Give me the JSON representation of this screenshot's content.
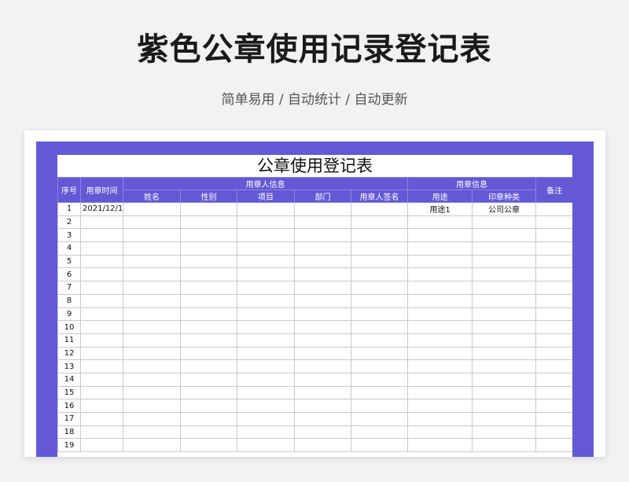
{
  "page": {
    "title": "紫色公章使用记录登记表",
    "subtitle": "简单易用 / 自动统计 / 自动更新"
  },
  "sheet": {
    "title": "公章使用登记表",
    "headers": {
      "index": "序号",
      "time": "用章时间",
      "user_group": "用章人信息",
      "name": "姓名",
      "gender": "性别",
      "project": "项目",
      "department": "部门",
      "signature": "用章人签名",
      "seal_group": "用章信息",
      "purpose": "用途",
      "seal_type": "印章种类",
      "remark": "备注"
    },
    "rows": [
      {
        "index": "1",
        "time": "2021/12/1",
        "name": "",
        "gender": "",
        "project": "",
        "department": "",
        "signature": "",
        "purpose": "用途1",
        "seal_type": "公司公章",
        "remark": ""
      },
      {
        "index": "2"
      },
      {
        "index": "3"
      },
      {
        "index": "4"
      },
      {
        "index": "5"
      },
      {
        "index": "6"
      },
      {
        "index": "7"
      },
      {
        "index": "8"
      },
      {
        "index": "9"
      },
      {
        "index": "10"
      },
      {
        "index": "11"
      },
      {
        "index": "12"
      },
      {
        "index": "13"
      },
      {
        "index": "14"
      },
      {
        "index": "15"
      },
      {
        "index": "16"
      },
      {
        "index": "17"
      },
      {
        "index": "18"
      },
      {
        "index": "19"
      }
    ]
  },
  "colors": {
    "accent": "#6359d4",
    "background": "#f2f2f4"
  }
}
